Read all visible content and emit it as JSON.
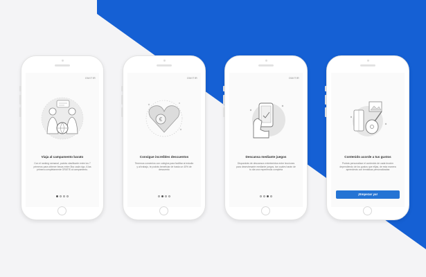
{
  "colors": {
    "accent": "#1560d4",
    "background": "#f4f4f6",
    "button": "#2474d4"
  },
  "screens": [
    {
      "skip": "OMITIR",
      "title": "Viaja al campamento barato",
      "description": "Con el ranking semanal, podrás clasificarte entre los 7 primeros para obtener becas entre 3ba cada vigo. A las primera completamente GRATIS al campamento.",
      "illustration": "people-chat-globe-icon",
      "page_index": 0
    },
    {
      "skip": "OMITIR",
      "title": "Consigue increíbles descuentos",
      "description": "Tenemos convenios con colegios para facilitar al estudio y al trabajo, te podrás beneficiar de hasta un 40% de descuento",
      "illustration": "heart-coin-icon",
      "page_index": 1
    },
    {
      "skip": "OMITIR",
      "title": "Descansa mediante juegos",
      "description": "Dispondrás de descansos entretenidos entre lecciones para desestresarte mediante juegos, tan cuales harán de tu día una experiencia completa",
      "illustration": "phone-game-hand-icon",
      "page_index": 2
    },
    {
      "skip": "",
      "title": "Contenido acorde a tus gustos",
      "description": "Podrás personalizar el contenido de cada lección dependiendo de los gustos que elijas, de esta manera aprenderás con temáticas personalizadas",
      "illustration": "music-guitar-icon",
      "button": "¡Empezar ya!",
      "page_index": 3
    }
  ]
}
